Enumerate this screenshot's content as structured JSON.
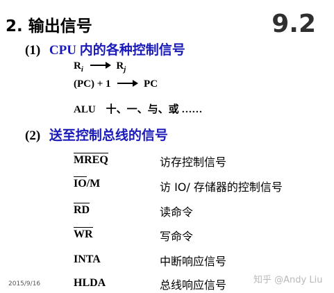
{
  "slide": {
    "title": "2. 输出信号",
    "number": "9.2",
    "date": "2015/9/16",
    "watermark": "知乎 @Andy Liu"
  },
  "section1": {
    "num": "(1)",
    "heading": "CPU 内的各种控制信号",
    "line1_left": "R",
    "line1_left_sub": "i",
    "line1_right": "R",
    "line1_right_sub": "j",
    "line2_left": "(PC) + 1",
    "line2_right": "PC",
    "line3": "ALU　十、一、与、或 ……"
  },
  "section2": {
    "num": "(2)",
    "heading": "送至控制总线的信号",
    "signals": [
      {
        "code": "MREQ",
        "desc": "访存控制信号"
      },
      {
        "code": "IO/M",
        "code_over": "IO",
        "code_rest": "/M",
        "desc": "访 IO/ 存储器的控制信号"
      },
      {
        "code": "RD",
        "desc": "读命令"
      },
      {
        "code": "WR",
        "desc": "写命令"
      },
      {
        "code": "INTA",
        "desc": "中断响应信号"
      },
      {
        "code": "HLDA",
        "desc": "总线响应信号"
      }
    ]
  }
}
